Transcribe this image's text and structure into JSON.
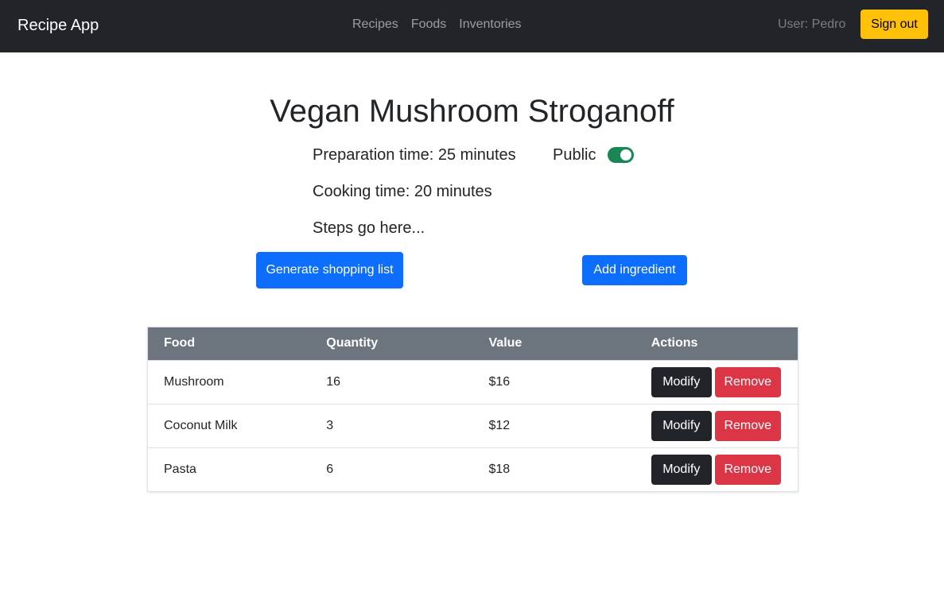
{
  "navbar": {
    "brand": "Recipe App",
    "links": [
      {
        "label": "Recipes"
      },
      {
        "label": "Foods"
      },
      {
        "label": "Inventories"
      }
    ],
    "user_label": "User: Pedro",
    "signout_label": "Sign out"
  },
  "recipe": {
    "title": "Vegan Mushroom Stroganoff",
    "preparation_time": "Preparation time: 25 minutes",
    "cooking_time": "Cooking time: 20 minutes",
    "steps": "Steps go here...",
    "public_label": "Public",
    "public": true
  },
  "actions": {
    "shopping_list_label": "Generate shopping list",
    "add_ingredient_label": "Add ingredient"
  },
  "table": {
    "headers": [
      "Food",
      "Quantity",
      "Value",
      "Actions"
    ],
    "rows": [
      {
        "food": "Mushroom",
        "quantity": "16",
        "value": "$16"
      },
      {
        "food": "Coconut Milk",
        "quantity": "3",
        "value": "$12"
      },
      {
        "food": "Pasta",
        "quantity": "6",
        "value": "$18"
      }
    ],
    "modify_label": "Modify",
    "remove_label": "Remove"
  },
  "colors": {
    "navbar_bg": "#212529",
    "signout": "#ffc107",
    "primary": "#0d6efd",
    "switch_on": "#198754",
    "table_header": "#6c757d",
    "danger": "#dc3545"
  }
}
